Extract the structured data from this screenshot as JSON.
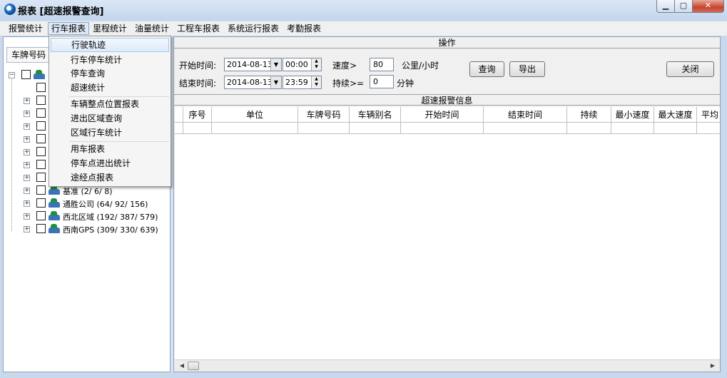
{
  "window": {
    "title": "报表 [超速报警查询]",
    "min_label": "▁",
    "max_label": "▢",
    "close_label": "✕"
  },
  "menubar": {
    "items": [
      "报警统计",
      "行车报表",
      "里程统计",
      "油量统计",
      "工程车报表",
      "系统运行报表",
      "考勤报表"
    ]
  },
  "dropdown": {
    "items": [
      "行驶轨迹",
      "行车停车统计",
      "停车查询",
      "超速统计",
      "车辆整点位置报表",
      "进出区域查询",
      "区域行车统计",
      "用车报表",
      "停车点进出统计",
      "途经点报表"
    ]
  },
  "left": {
    "combo": "车牌号码",
    "tree": [
      {
        "label": "基准 (2/ 6/ 8)"
      },
      {
        "label": "通胜公司 (64/ 92/ 156)"
      },
      {
        "label": "西北区域 (192/ 387/ 579)"
      },
      {
        "label": "西南GPS (309/ 330/ 639)"
      }
    ]
  },
  "ops": {
    "title": "操作",
    "start_label": "开始时间:",
    "start_date": "2014-08-13",
    "start_time": "00:00",
    "end_label": "结束时间:",
    "end_date": "2014-08-13",
    "end_time": "23:59",
    "speed_label": "速度>",
    "speed_value": "80",
    "speed_unit": "公里/小时",
    "duration_label": "持续>=",
    "duration_value": "0",
    "duration_unit": "分钟",
    "query_button": "查询",
    "export_button": "导出",
    "close_button": "关闭"
  },
  "results": {
    "title": "超速报警信息",
    "columns": [
      "序号",
      "单位",
      "车牌号码",
      "车辆别名",
      "开始时间",
      "结束时间",
      "持续",
      "最小速度",
      "最大速度",
      "平均"
    ]
  }
}
